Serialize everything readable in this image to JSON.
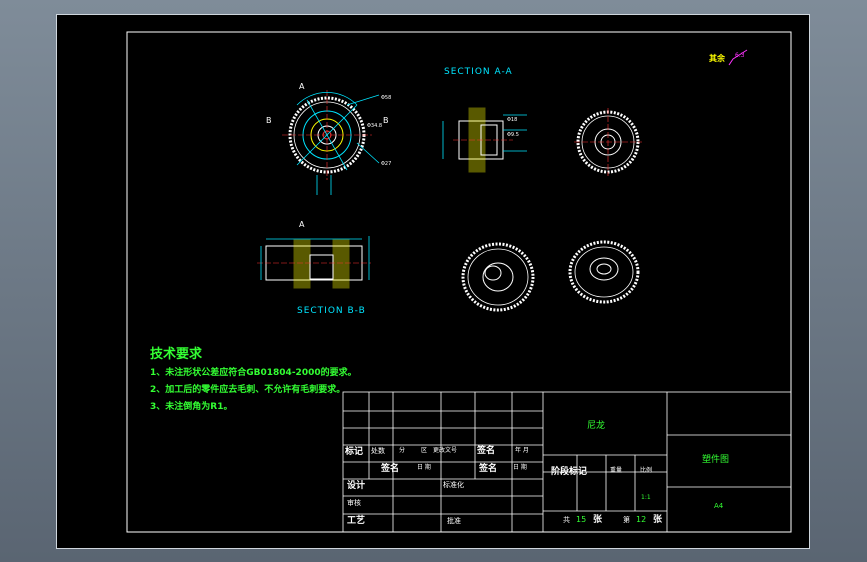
{
  "section_aa": "SECTION A-A",
  "section_bb": "SECTION B-B",
  "view_labels": {
    "a_top": "A",
    "b_left": "B",
    "b_right": "B",
    "a_bottom": "A"
  },
  "roughness": {
    "label": "其余",
    "value": "6.3"
  },
  "tech_req": {
    "title": "技术要求",
    "items": [
      "1、未注形状公差应符合GB01804-2000的要求。",
      "2、加工后的零件应去毛刺、不允许有毛刺要求。",
      "3、未注倒角为R1。"
    ]
  },
  "title_block": {
    "material": "尼龙",
    "part_name": "塑件图",
    "mark": "标记",
    "count": "处数",
    "zone": "分",
    "zone2": "区",
    "change_doc": "更改文号",
    "sign": "签名",
    "date_ym": "年 月",
    "sign2": "签名",
    "date": "日 期",
    "sign3": "签名",
    "date2": "日 期",
    "stage_mark": "阶段标记",
    "weight": "重量",
    "scale": "比例",
    "design": "设计",
    "standard": "标准化",
    "review": "审核",
    "process": "工艺",
    "approve": "批准",
    "scale_value": "1:1",
    "size": "A4",
    "total_label": "共",
    "total": "15",
    "sheet_unit": "张",
    "sheet_label": "第",
    "sheet_no": "12",
    "sheet_unit2": "张"
  },
  "colors": {
    "frame": "#ffffff",
    "dim": "#00e5ff",
    "hatch": "#ffff00",
    "text": "#33ff33",
    "center": "#ff3333"
  }
}
